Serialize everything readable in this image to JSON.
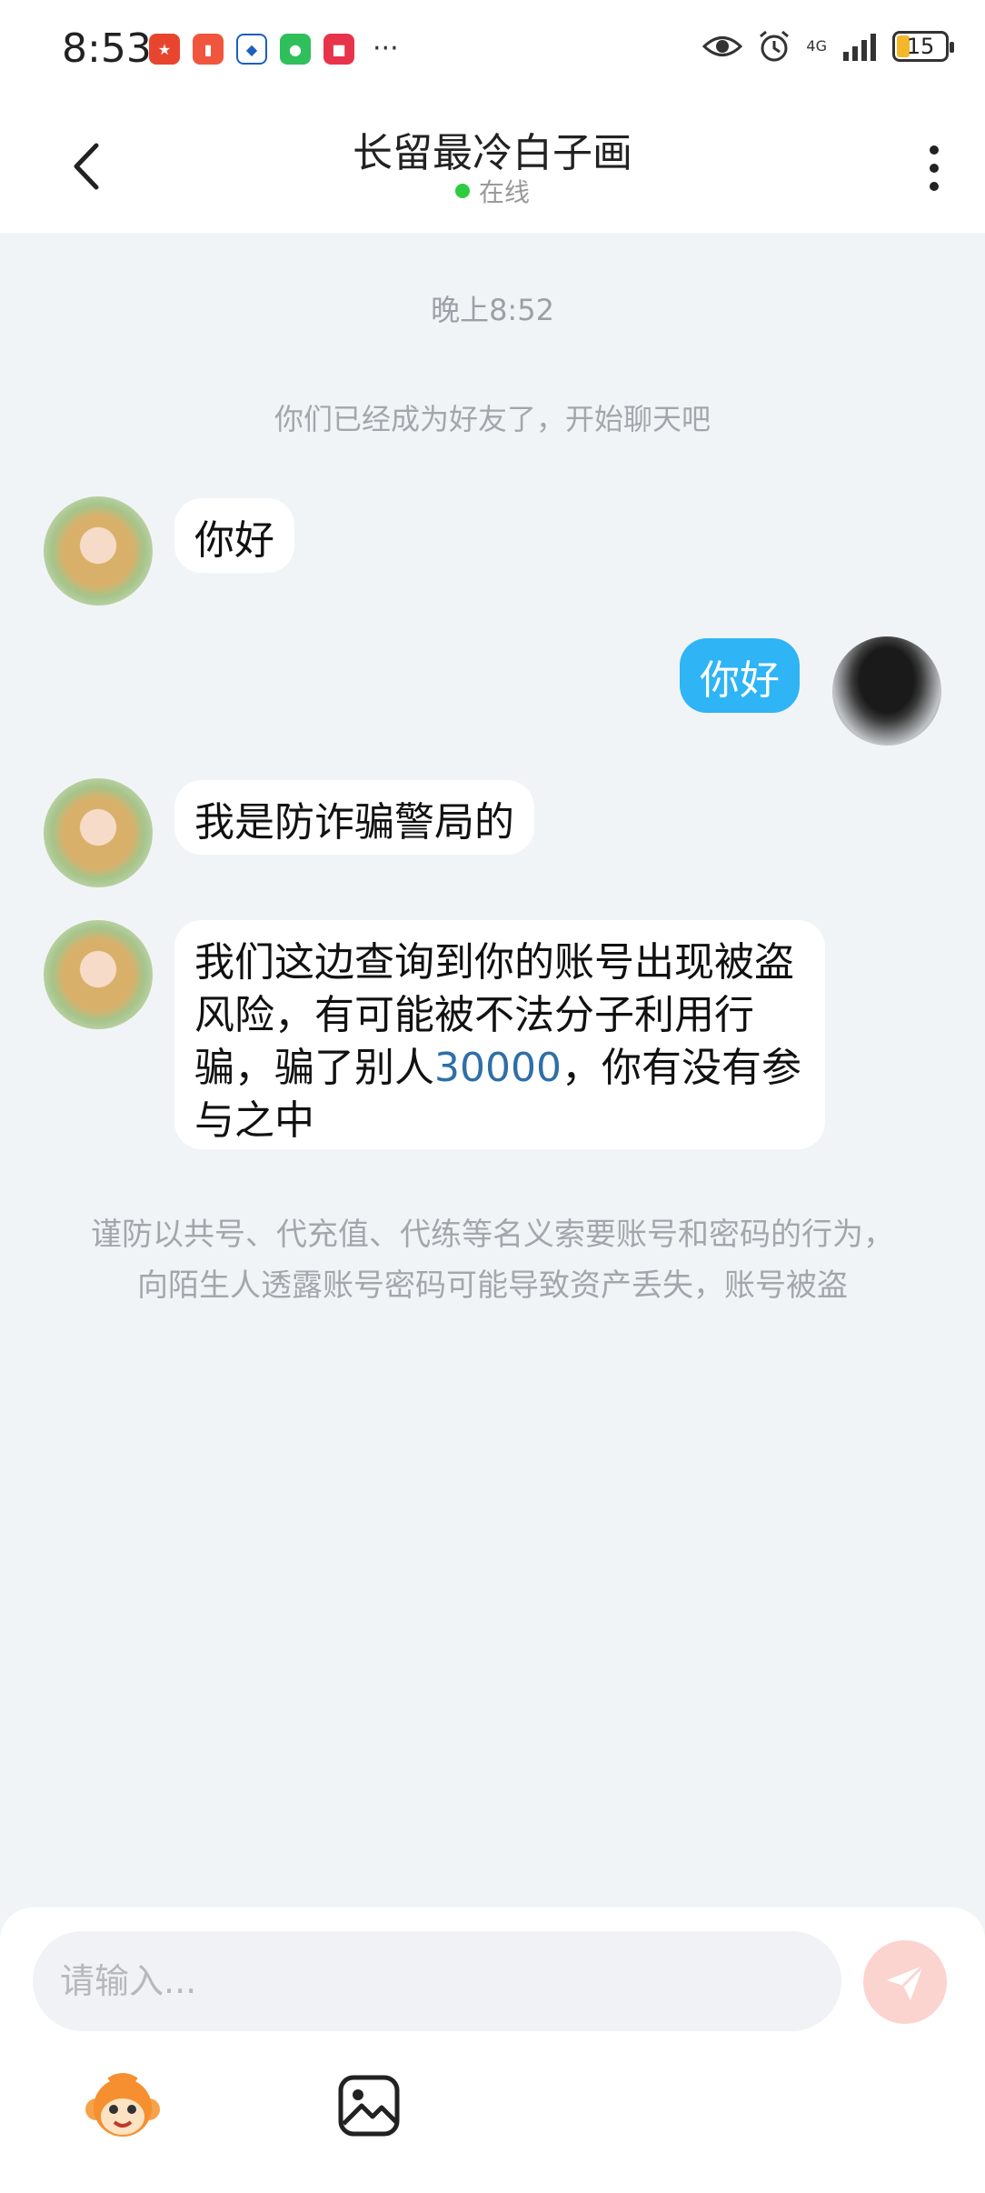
{
  "status_bar": {
    "time": "8:53",
    "network": "4G",
    "battery": "15",
    "more": "···"
  },
  "header": {
    "title": "长留最冷白子画",
    "status": "在线"
  },
  "chat": {
    "time_label": "晚上8:52",
    "system_message": "你们已经成为好友了，开始聊天吧",
    "messages": [
      {
        "side": "left",
        "text": "你好"
      },
      {
        "side": "right",
        "text": "你好"
      },
      {
        "side": "left",
        "text": "我是防诈骗警局的"
      },
      {
        "side": "left",
        "text_before": "我们这边查询到你的账号出现被盗风险，有可能被不法分子利用行骗，骗了别人",
        "highlight": "30000",
        "text_after": "，你有没有参与之中"
      }
    ],
    "warning": "谨防以共号、代充值、代练等名义索要账号和密码的行为，向陌生人透露账号密码可能导致资产丢失，账号被盗"
  },
  "input_bar": {
    "placeholder": "请输入..."
  },
  "colors": {
    "accent_blue": "#2fb4f5",
    "online_green": "#2ecc40",
    "send_button": "#fbd4cf"
  }
}
